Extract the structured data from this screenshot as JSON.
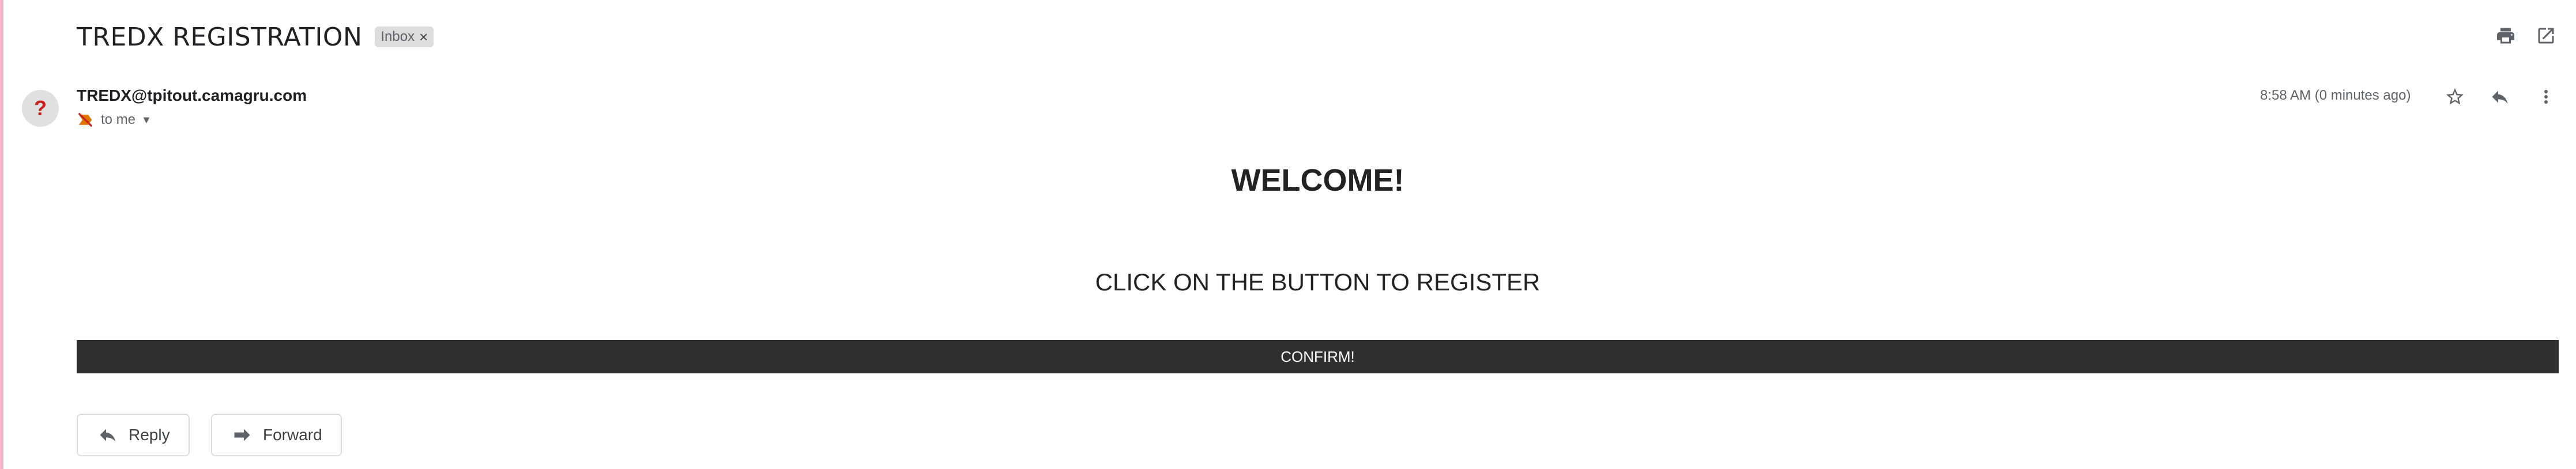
{
  "email": {
    "subject": "TREDX REGISTRATION",
    "label_chip": "Inbox",
    "label_remove": "×",
    "sender": "TREDX@tpitout.camagru.com",
    "recipient": "to me",
    "timestamp": "8:58 AM (0 minutes ago)",
    "avatar_glyph": "?"
  },
  "body": {
    "heading": "WELCOME!",
    "instruction": "CLICK ON THE BUTTON TO REGISTER",
    "confirm_label": "CONFIRM!"
  },
  "actions": {
    "reply_label": "Reply",
    "forward_label": "Forward"
  },
  "icons": {
    "print": "printer-icon",
    "open_new_window": "open-in-new-icon",
    "star": "star-icon",
    "reply": "reply-icon",
    "more": "more-vert-icon",
    "important": "not-important-icon",
    "forward": "forward-icon"
  },
  "colors": {
    "confirm_bar": "#2f2f2f",
    "left_accent": "#f4b6c9",
    "chip_bg": "#dddddd"
  }
}
